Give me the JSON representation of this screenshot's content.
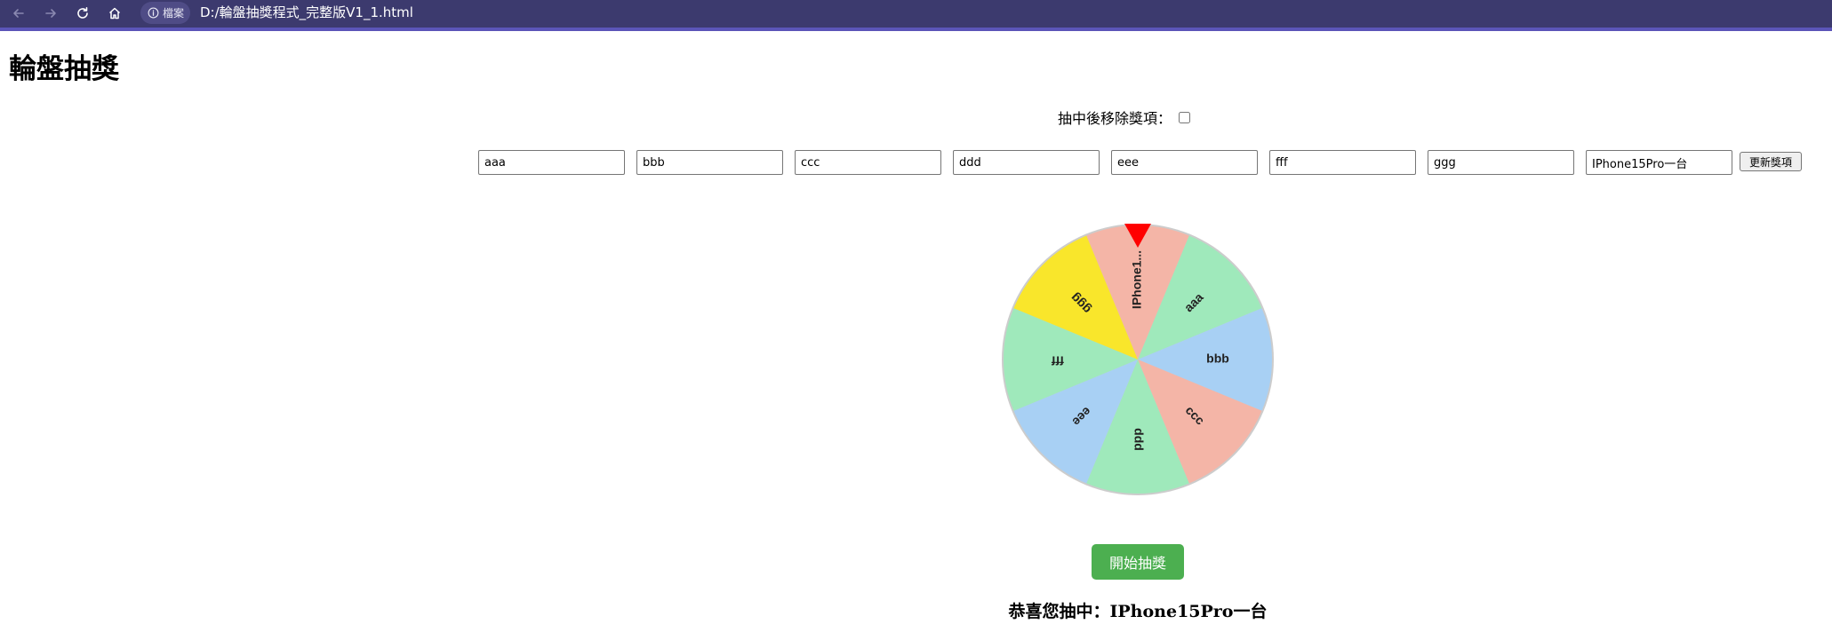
{
  "browser": {
    "site_info_label": "檔案",
    "url": "D:/輪盤抽獎程式_完整版V1_1.html"
  },
  "page": {
    "title": "輪盤抽獎",
    "remove_after_draw_label": "抽中後移除獎項：",
    "remove_after_draw_checked": false,
    "update_button_label": "更新獎項",
    "start_button_label": "開始抽獎",
    "result_text": "恭喜您抽中：IPhone15Pro一台"
  },
  "prizes": [
    {
      "value": "aaa"
    },
    {
      "value": "bbb"
    },
    {
      "value": "ccc"
    },
    {
      "value": "ddd"
    },
    {
      "value": "eee"
    },
    {
      "value": "fff"
    },
    {
      "value": "ggg"
    },
    {
      "value": "IPhone15Pro一台"
    }
  ],
  "wheel": {
    "pointer_color": "#ff0000",
    "border_color": "#cccccc",
    "segments": [
      {
        "label": "IPhone1...",
        "color": "#f4b5a7"
      },
      {
        "label": "aaa",
        "color": "#9fe9bb"
      },
      {
        "label": "bbb",
        "color": "#a8d0f4"
      },
      {
        "label": "ccc",
        "color": "#f4b5a7"
      },
      {
        "label": "ddd",
        "color": "#9fe9bb"
      },
      {
        "label": "eee",
        "color": "#a8d0f4"
      },
      {
        "label": "fff",
        "color": "#9fe9bb"
      },
      {
        "label": "ggg",
        "color": "#f9e62b"
      }
    ]
  }
}
